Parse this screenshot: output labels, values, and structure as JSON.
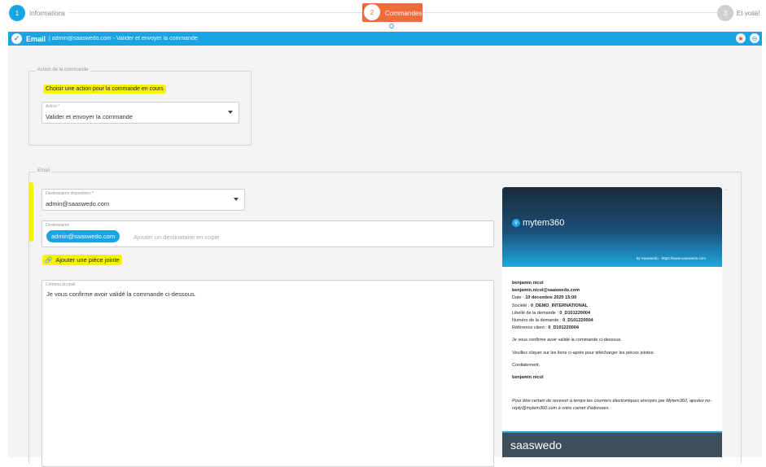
{
  "stepper": {
    "step1": {
      "number": "1",
      "label": "Informations"
    },
    "step2": {
      "number": "2",
      "label": "Commandes"
    },
    "step3": {
      "number": "3",
      "label": "Et voilà!"
    }
  },
  "bar": {
    "title": "Email",
    "subtitle": "| admin@saaswedo.com - Valider et envoyer la commande"
  },
  "action_section": {
    "legend": "Action de la commande",
    "hint": "Choisir une action pour la commande en cours",
    "select_label": "Action *",
    "select_value": "Valider et envoyer la commande"
  },
  "email_section": {
    "legend": "Email",
    "recipients_label": "Destinataires disponibles *",
    "recipients_value": "admin@saaswedo.com",
    "to_label": "Destinataires",
    "to_chip": "admin@saaswedo.com",
    "cc_placeholder": "Ajouter un destinataire en copie",
    "attach_label": "Ajouter une pièce jointe",
    "content_label": "Contenu du mail",
    "content_text": "Je vous confirme avoir validé la commande ci-dessous."
  },
  "preview": {
    "logo_text": "mytem360",
    "byline": "by Saaswedo - https://www.saaswedo.com",
    "name": "benjamin nicol",
    "email": "benjamin.nicol@saaswedo.com",
    "date_label": "Date :",
    "date_value": "10 décembre 2020 15:00",
    "company_label": "Société :",
    "company_value": "0_DEMO_INTERNATIONAL",
    "request_label": "Libellé de la demande :",
    "request_value": "0_D101220004",
    "number_label": "Numéro de la demande :",
    "number_value": "0_D101220004",
    "ref_label": "Référence client :",
    "ref_value": "0_D101220004",
    "line1": "Je vous confirme avoir validé la commande ci-dessous.",
    "line2": "Veuillez cliquer sur les liens ci-après pour télécharger les pièces jointes:",
    "line3": "Cordialement,",
    "signature": "benjamin nicol",
    "notice": "Pour être certain de recevoir à temps les courriers électroniques envoyés par Mytem360, ajoutez no-reply@mytem360.com à votre carnet d'adresses.",
    "footer_logo": "saaswedo"
  },
  "colors": {
    "accent": "#19a5e3",
    "active_step": "#f06a3a",
    "highlight": "#f5f400"
  }
}
